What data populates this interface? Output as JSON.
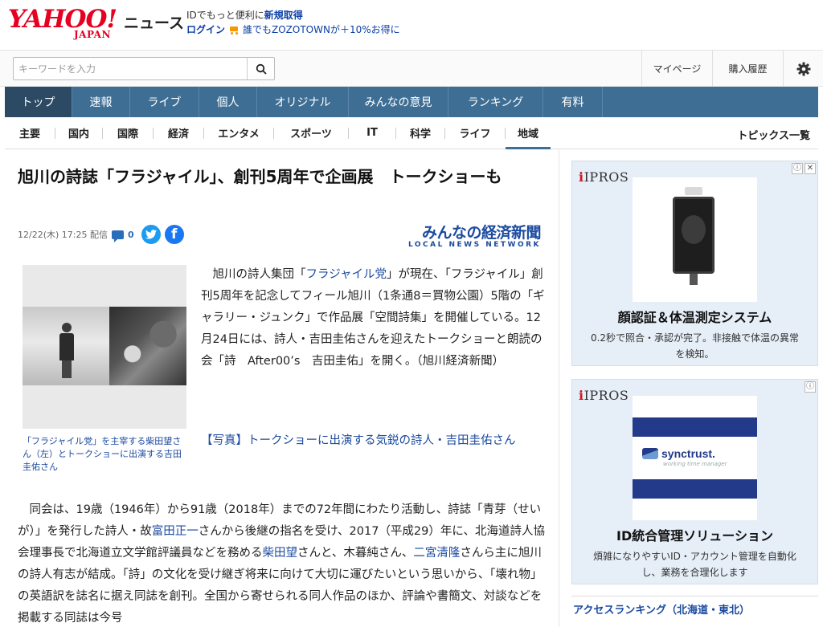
{
  "header": {
    "logo_yahoo": "YAHOO!",
    "logo_japan": "JAPAN",
    "section": "ニュース",
    "promo_text": "IDでもっと便利に",
    "promo_link": "新規取得",
    "login": "ログイン",
    "zozo_text": "誰でもZOZOTOWNが＋10%お得に"
  },
  "search": {
    "placeholder": "キーワードを入力",
    "mypage": "マイページ",
    "history": "購入履歴"
  },
  "main_nav": [
    "トップ",
    "速報",
    "ライブ",
    "個人",
    "オリジナル",
    "みんなの意見",
    "ランキング",
    "有料"
  ],
  "sub_nav": [
    "主要",
    "国内",
    "国際",
    "経済",
    "エンタメ",
    "スポーツ",
    "IT",
    "科学",
    "ライフ",
    "地域"
  ],
  "topics_link": "トピックス一覧",
  "article": {
    "title": "旭川の詩誌「フラジャイル」、創刊5周年で企画展　トークショーも",
    "date": "12/22(木) 17:25 配信",
    "comments": "0",
    "publisher_big": "みんなの経済新聞",
    "publisher_small": "LOCAL NEWS NETWORK",
    "caption": "「フラジャイル党」を主宰する柴田望さん（左）とトークショーに出演する吉田圭佑さん",
    "lead_1": "旭川の詩人集団「",
    "lead_link1": "フラジャイル党",
    "lead_2": "」が現在、「フラジャイル」創刊5周年を記念してフィール旭川（1条通8＝買物公園）5階の「ギャラリー・ジュンク」で作品展「空間詩集」を開催している。12月24日には、詩人・吉田圭佑さんを迎えたトークショーと朗読の会「詩　After00’s　吉田圭佑」を開く。（旭川経済新聞）",
    "photo_link": "【写真】トークショーに出演する気鋭の詩人・吉田圭佑さん",
    "body_1": "同会は、19歳（1946年）から91歳（2018年）までの72年間にわたり活動し、詩誌「青芽（せいが）」を発行した詩人・故",
    "body_link1": "富田正一",
    "body_2": "さんから後継の指名を受け、2017（平成29）年に、北海道詩人協会理事長で北海道立文学館評議員などを務める",
    "body_link2": "柴田望",
    "body_3": "さんと、木暮純さん、",
    "body_link3": "二宮清隆",
    "body_4": "さんら主に旭川の詩人有志が結成。「詩」の文化を受け継ぎ将来に向けて大切に運びたいという思いから、「壊れ物」の英語訳を誌名に据え同誌を創刊。全国から寄せられる同人作品のほか、評論や書簡文、対談などを掲載する同誌は今号"
  },
  "ads": [
    {
      "brand": "IPROS",
      "headline": "顔認証＆体温測定システム",
      "desc": "0.2秒で照合・承認が完了。非接触で体温の異常を検知。"
    },
    {
      "brand": "IPROS",
      "logo": "synctrust.",
      "logo_sub": "working time manager",
      "headline": "ID統合管理ソリューション",
      "desc": "煩雑になりやすいID・アカウント管理を自動化し、業務を合理化します"
    }
  ],
  "ranking_title": "アクセスランキング（北海道・東北）",
  "colors": {
    "yahoo_red": "#e60022",
    "nav_blue": "#3f6e94",
    "link_blue": "#1b4aa0"
  }
}
